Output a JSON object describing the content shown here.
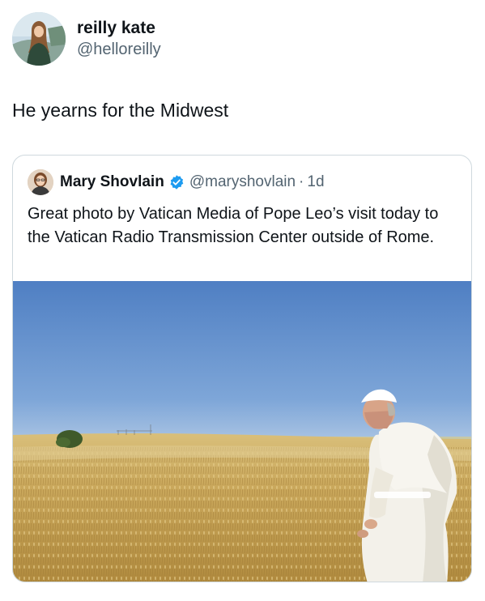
{
  "tweet": {
    "author": {
      "display_name": "reilly kate",
      "handle": "@helloreilly",
      "avatar_icon": "profile-photo-woman-icon"
    },
    "text": "He yearns for the Midwest"
  },
  "quoted_tweet": {
    "author": {
      "display_name": "Mary Shovlain",
      "handle": "@maryshovlain",
      "verified": true,
      "avatar_icon": "profile-photo-woman-icon"
    },
    "separator": "·",
    "time": "1d",
    "text": "Great photo by Vatican Media of Pope Leo’s visit today to the Vatican Radio Transmission Center outside of Rome.",
    "media": {
      "type": "photo",
      "icon": "photo-pope-in-wheat-field"
    }
  },
  "colors": {
    "primary_text": "#0f1419",
    "secondary_text": "#536471",
    "verified_badge": "#1d9bf0",
    "card_border": "#cfd9de"
  }
}
